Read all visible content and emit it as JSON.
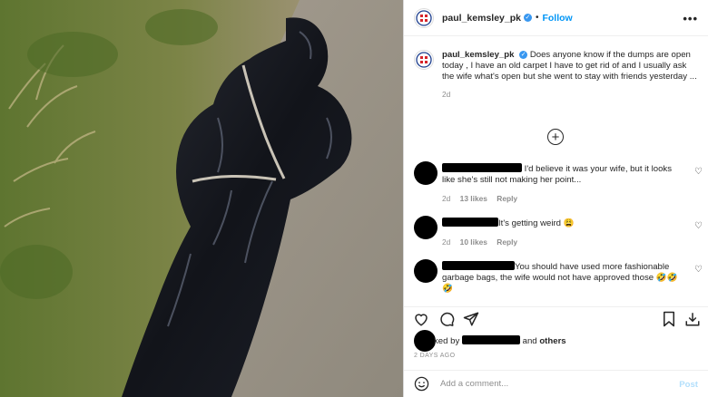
{
  "post": {
    "username": "paul_kemsley_pk",
    "follow_label": "Follow",
    "separator": "•",
    "more_label": "•••",
    "caption": "Does anyone know if the dumps are open today , I have an old carpet I have to get rid of and I usually ask the wife what's open but she went to stay with friends yesterday ...",
    "caption_time": "2d",
    "load_more_label": "+"
  },
  "comments": [
    {
      "text": "I'd believe it was your wife, but it looks like she's still not making her point...",
      "time": "2d",
      "likes": "13 likes",
      "reply": "Reply"
    },
    {
      "text": "It's getting weird 😩",
      "time": "2d",
      "likes": "10 likes",
      "reply": "Reply"
    },
    {
      "text": "You should have used more fashionable garbage bags, the wife would not have approved those 🤣🤣🤣"
    }
  ],
  "likes": {
    "prefix": "ked by",
    "and_label": "and",
    "others_label": "others"
  },
  "posted_ago": "2 DAYS AGO",
  "add_comment": {
    "placeholder": "Add a comment...",
    "post_label": "Post"
  },
  "colors": {
    "follow": "#0095f6",
    "verified": "#3897f0",
    "post_disabled": "#b2dffc",
    "muted": "#8e8e8e"
  },
  "icons": [
    "verified-icon",
    "more-options-icon",
    "add-circle-icon",
    "heart-icon",
    "comment-icon",
    "share-icon",
    "bookmark-icon",
    "download-icon",
    "emoji-icon"
  ]
}
